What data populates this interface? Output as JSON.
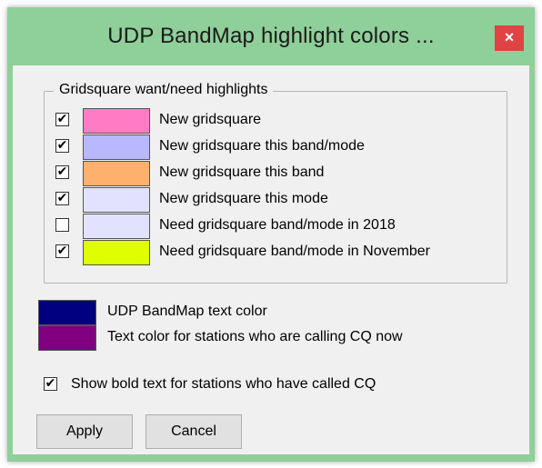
{
  "window": {
    "title": "UDP BandMap highlight colors ...",
    "close_glyph": "×"
  },
  "group": {
    "label": "Gridsquare want/need highlights",
    "items": [
      {
        "checked": true,
        "color": "#ff7cc4",
        "label": "New gridsquare"
      },
      {
        "checked": true,
        "color": "#b8b8ff",
        "label": "New gridsquare this band/mode"
      },
      {
        "checked": true,
        "color": "#ffb06c",
        "label": "New gridsquare this band"
      },
      {
        "checked": true,
        "color": "#e2e2ff",
        "label": "New gridsquare this mode"
      },
      {
        "checked": false,
        "color": "#e2e2ff",
        "label": "Need gridsquare band/mode in 2018"
      },
      {
        "checked": true,
        "color": "#dfff00",
        "label": "Need gridsquare band/mode in November"
      }
    ]
  },
  "text_colors": [
    {
      "color": "#000080",
      "label": "UDP BandMap text color"
    },
    {
      "color": "#800080",
      "label": "Text color for stations who are calling CQ now"
    }
  ],
  "bold_option": {
    "checked": true,
    "label": "Show bold text for stations who have called CQ"
  },
  "buttons": {
    "apply": "Apply",
    "cancel": "Cancel"
  },
  "checkbox_glyph": "✔"
}
